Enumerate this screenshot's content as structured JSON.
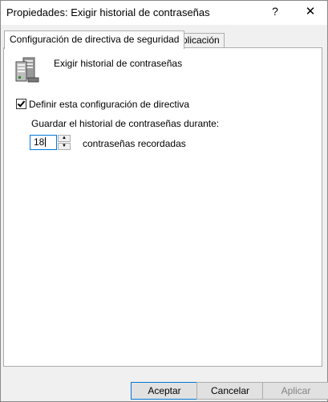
{
  "window": {
    "title": "Propiedades: Exigir historial de contraseñas",
    "help_glyph": "?",
    "close_glyph": "✕"
  },
  "tabs": [
    {
      "label": "Configuración de directiva de seguridad",
      "active": true
    },
    {
      "label": "Explicación",
      "active": false
    }
  ],
  "policy": {
    "icon": "server-policy-icon",
    "name": "Exigir historial de contraseñas"
  },
  "define_setting": {
    "label": "Definir esta configuración de directiva",
    "checked": true
  },
  "history": {
    "label": "Guardar el historial de contraseñas durante:",
    "value": "18",
    "suffix": "contraseñas recordadas"
  },
  "buttons": {
    "ok": "Aceptar",
    "cancel": "Cancelar",
    "apply": "Aplicar"
  },
  "colors": {
    "focus_border": "#0078d7",
    "dialog_background": "#f0f0f0",
    "disabled_text": "#838383"
  }
}
